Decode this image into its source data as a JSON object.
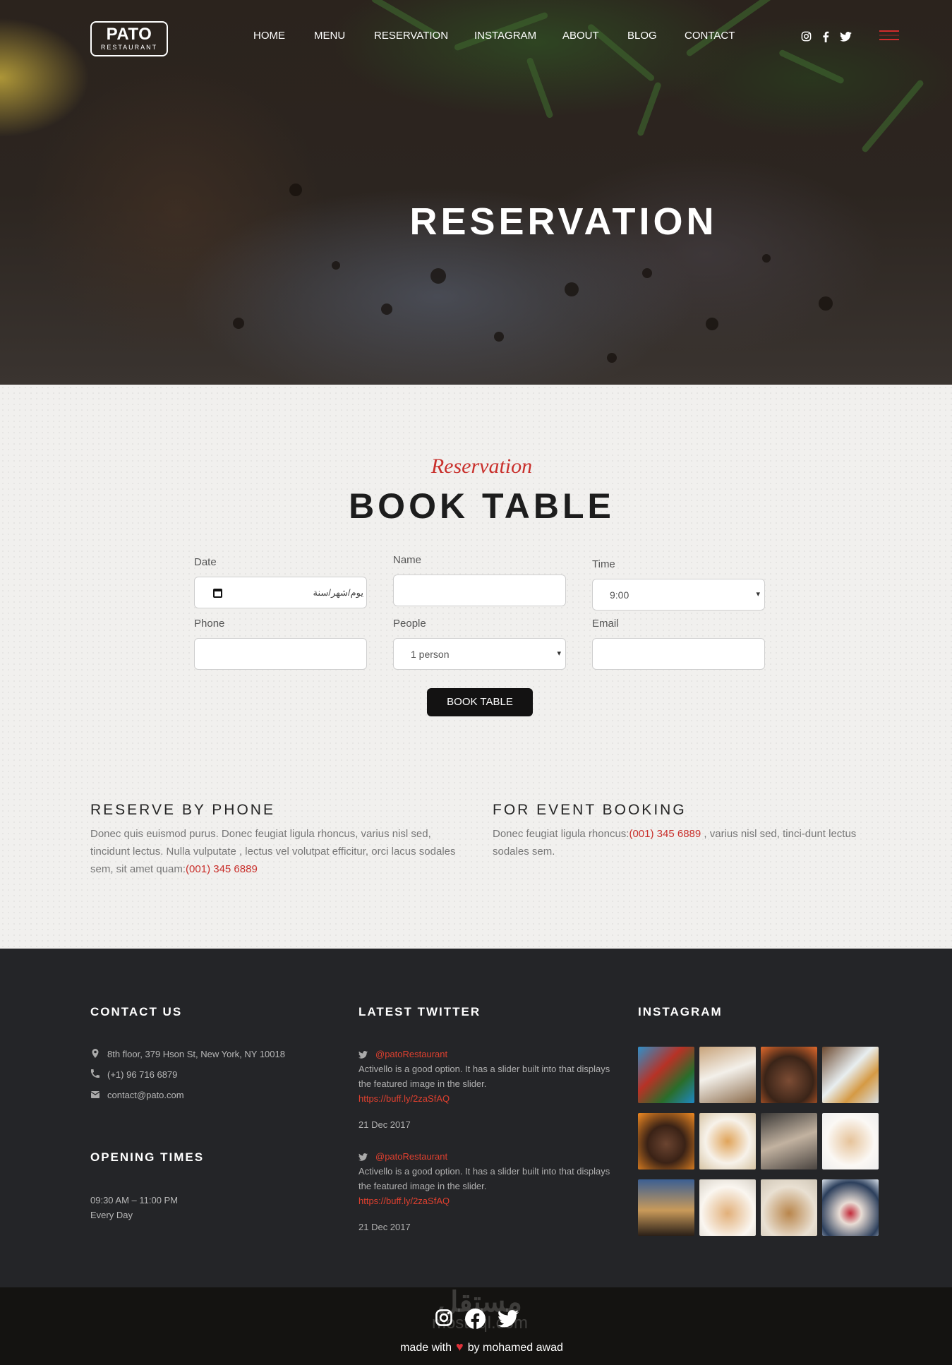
{
  "brand": {
    "name": "PATO",
    "sub": "RESTAURANT"
  },
  "nav": [
    "HOME",
    "MENU",
    "RESERVATION",
    "INSTAGRAM",
    "ABOUT",
    "BLOG",
    "CONTACT"
  ],
  "hero": {
    "title": "RESERVATION"
  },
  "booking": {
    "subtitle": "Reservation",
    "title": "BOOK TABLE",
    "date_label": "Date",
    "date_value": "يوم/شهر/سنة",
    "name_label": "Name",
    "name_value": "",
    "time_label": "Time",
    "time_value": "9:00",
    "phone_label": "Phone",
    "phone_value": "",
    "people_label": "People",
    "people_value": "1 person",
    "email_label": "Email",
    "email_value": "",
    "button": "BOOK TABLE"
  },
  "phone_block": {
    "title": "RESERVE BY PHONE",
    "text": "Donec quis euismod purus. Donec feugiat ligula rhoncus, varius nisl sed, tincidunt lectus. Nulla vulputate , lectus vel volutpat efficitur, orci lacus sodales sem, sit amet quam:",
    "phone": "(001) 345 6889"
  },
  "event_block": {
    "title": "FOR EVENT BOOKING",
    "text_before": "Donec feugiat ligula rhoncus:",
    "phone": "(001) 345 6889",
    "text_after": " , varius nisl sed, tinci-dunt lectus sodales sem."
  },
  "footer": {
    "contact_title": "CONTACT US",
    "address": "8th floor, 379 Hson St, New York, NY 10018",
    "tel": "(+1) 96 716 6879",
    "email": "contact@pato.com",
    "opening_title": "OPENING TIMES",
    "hours": "09:30 AM – 11:00 PM",
    "days": "Every Day",
    "twitter_title": "LATEST TWITTER",
    "tweets": [
      {
        "handle": "@patoRestaurant",
        "text": "Activello is a good option. It has a slider built into that displays the featured image in the slider.",
        "link": "https://buff.ly/2zaSfAQ",
        "date": "21 Dec 2017"
      },
      {
        "handle": "@patoRestaurant",
        "text": "Activello is a good option. It has a slider built into that displays the featured image in the slider.",
        "link": "https://buff.ly/2zaSfAQ",
        "date": "21 Dec 2017"
      }
    ],
    "instagram_title": "INSTAGRAM"
  },
  "bottom": {
    "made_before": "made with",
    "made_after": "by mohamed awad",
    "watermark": "مستقل",
    "watermark_sub": "mostaql.com"
  },
  "colors": {
    "accent": "#c9302c",
    "footer_bg": "#242528",
    "bottom_bg": "#141311"
  }
}
